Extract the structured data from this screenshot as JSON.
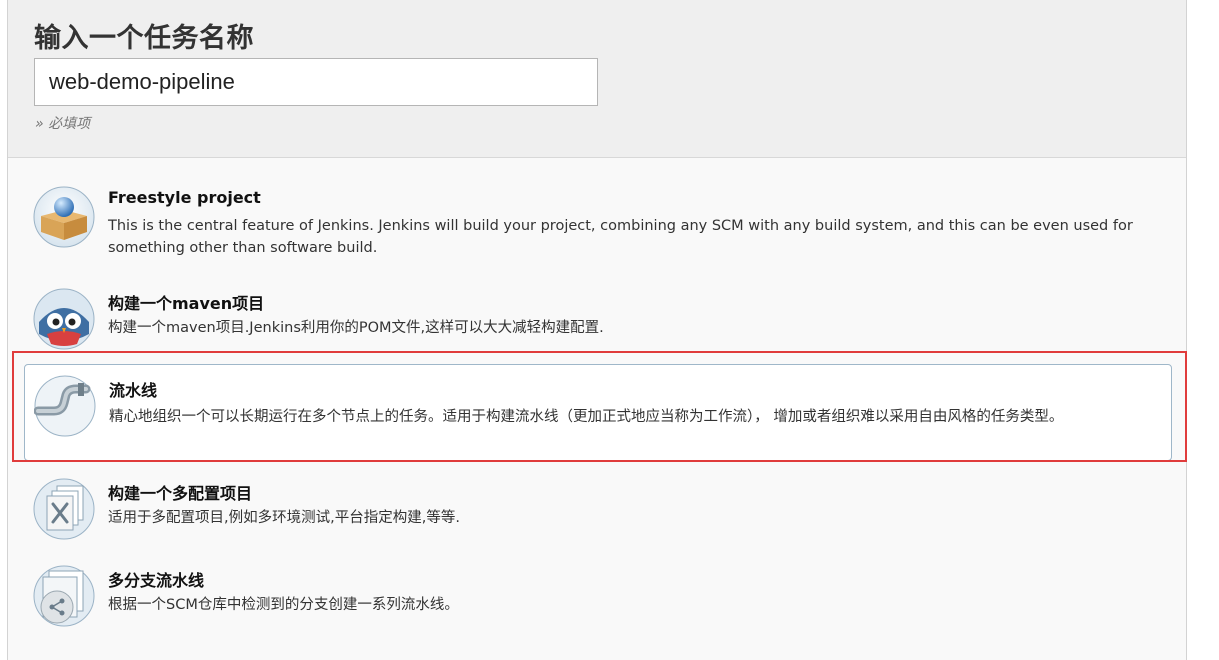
{
  "header": {
    "title": "输入一个任务名称",
    "item_name_value": "web-demo-pipeline",
    "required_hint": "» 必填项"
  },
  "job_types": [
    {
      "name": "Freestyle project",
      "description": "This is the central feature of Jenkins. Jenkins will build your project, combining any SCM with any build system, and this can be even used for something other than software build.",
      "icon": "freestyle-box-icon"
    },
    {
      "name": "构建一个maven项目",
      "description": "构建一个maven项目.Jenkins利用你的POM文件,这样可以大大减轻构建配置.",
      "icon": "maven-owl-icon"
    },
    {
      "name": "流水线",
      "description": "精心地组织一个可以长期运行在多个节点上的任务。适用于构建流水线（更加正式地应当称为工作流）， 增加或者组织难以采用自由风格的任务类型。",
      "icon": "pipeline-icon",
      "selected": true
    },
    {
      "name": "构建一个多配置项目",
      "description": "适用于多配置项目,例如多环境测试,平台指定构建,等等.",
      "icon": "multi-config-icon"
    },
    {
      "name": "多分支流水线",
      "description": "根据一个SCM仓库中检测到的分支创建一系列流水线。",
      "icon": "multibranch-pipeline-icon"
    }
  ],
  "colors": {
    "selected_border": "#9fb7c9",
    "highlight_annotation": "#e03c3c",
    "header_bg": "#efefef"
  }
}
